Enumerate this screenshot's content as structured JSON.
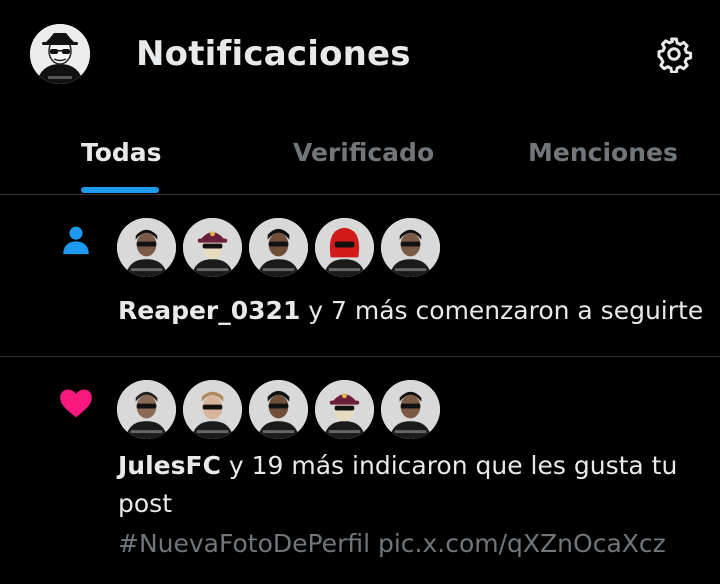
{
  "header": {
    "title": "Notificaciones",
    "avatar_icon": "user-avatar",
    "settings_icon": "gear-icon"
  },
  "tabs": [
    {
      "label": "Todas",
      "active": true
    },
    {
      "label": "Verificado",
      "active": false
    },
    {
      "label": "Menciones",
      "active": false
    }
  ],
  "colors": {
    "accent": "#1d9bf0",
    "like": "#f91880",
    "muted": "#71767b",
    "text": "#e7e9ea"
  },
  "notifications": [
    {
      "type": "follow",
      "icon": "person-icon",
      "user": "Reaper_0321",
      "text": " y 7 más comenzaron a seguirte",
      "avatars": [
        "avatar-guy-sunglasses",
        "avatar-barca-cap",
        "avatar-guy-sunglasses",
        "avatar-red-mask",
        "avatar-guy-sunglasses"
      ]
    },
    {
      "type": "like",
      "icon": "heart-icon",
      "user": "JulesFC",
      "text": " y 19 más indicaron que les gusta tu post",
      "post_text": "#NuevaFotoDePerfil pic.x.com/qXZnOcaXcz",
      "avatars": [
        "avatar-guy-sunglasses",
        "avatar-blond-sunglasses",
        "avatar-guy-sunglasses",
        "avatar-barca-cap",
        "avatar-guy-sunglasses"
      ]
    }
  ]
}
